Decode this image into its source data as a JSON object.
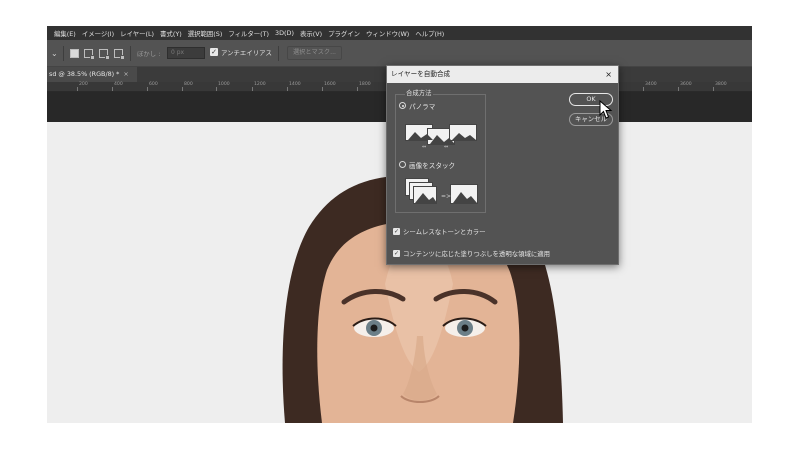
{
  "menu": [
    "編集(E)",
    "イメージ(I)",
    "レイヤー(L)",
    "書式(Y)",
    "選択範囲(S)",
    "フィルター(T)",
    "3D(D)",
    "表示(V)",
    "プラグイン",
    "ウィンドウ(W)",
    "ヘルプ(H)"
  ],
  "options": {
    "feather_label": "ぼかし :",
    "feather_value": "0 px",
    "antialias_label": "アンチエイリアス",
    "mask_button": "選択とマスク..."
  },
  "tab": {
    "title": "sd @ 38.5% (RGB/8) *",
    "close": "×"
  },
  "ruler": {
    "labels": [
      "200",
      "400",
      "600",
      "800",
      "1000",
      "1200",
      "1400",
      "1600",
      "1800",
      "3400",
      "3600",
      "3800"
    ]
  },
  "dialog": {
    "title": "レイヤーを自動合成",
    "close": "×",
    "group_label": "合成方法",
    "options": [
      {
        "label": "パノラマ",
        "selected": true
      },
      {
        "label": "画像をスタック",
        "selected": false
      }
    ],
    "checkboxes": [
      {
        "label": "シームレスなトーンとカラー",
        "checked": true
      },
      {
        "label": "コンテンツに応じた塗りつぶしを透明な領域に適用",
        "checked": true
      }
    ],
    "ok": "OK",
    "cancel": "キャンセル"
  },
  "colors": {
    "ui_bg": "#535353",
    "menu_bg": "#323232",
    "canvas_bg": "#eeeeee",
    "dialog_title_bg": "#ececec"
  }
}
